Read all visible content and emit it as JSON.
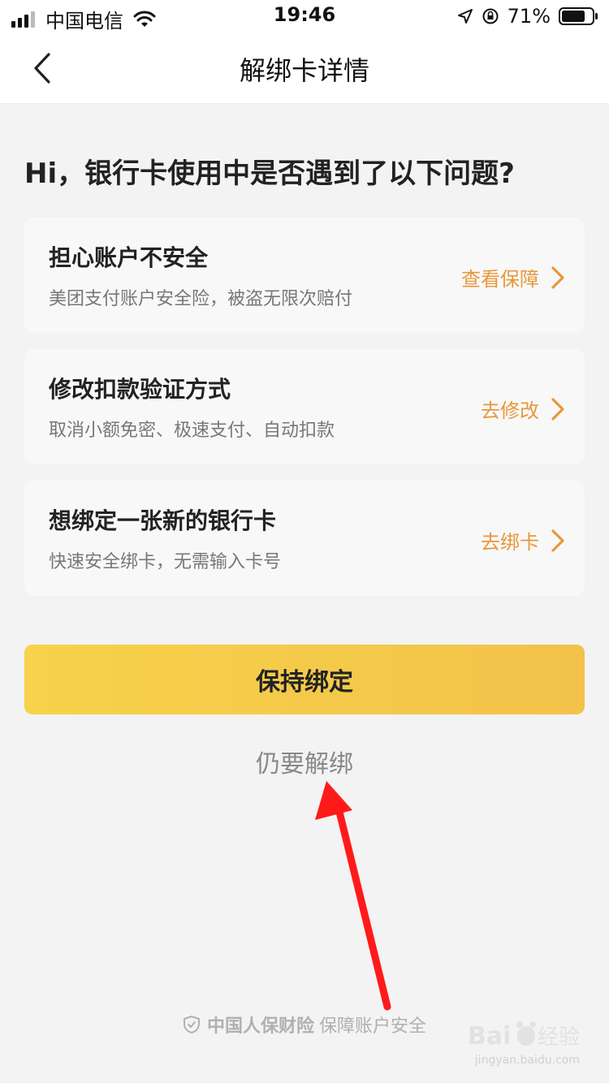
{
  "status_bar": {
    "carrier": "中国电信",
    "time": "19:46",
    "battery": "71%",
    "icons": [
      "signal-icon",
      "wifi-icon",
      "location-arrow-icon",
      "rotation-lock-icon",
      "battery-icon"
    ]
  },
  "nav": {
    "title": "解绑卡详情",
    "back_icon": "chevron-left-icon"
  },
  "heading": "Hi，银行卡使用中是否遇到了以下问题?",
  "cards": [
    {
      "title": "担心账户不安全",
      "description": "美团支付账户安全险，被盗无限次赔付",
      "action": "查看保障"
    },
    {
      "title": "修改扣款验证方式",
      "description": "取消小额免密、极速支付、自动扣款",
      "action": "去修改"
    },
    {
      "title": "想绑定一张新的银行卡",
      "description": "快速安全绑卡，无需输入卡号",
      "action": "去绑卡"
    }
  ],
  "buttons": {
    "keep_bind": "保持绑定",
    "unbind": "仍要解绑"
  },
  "footer": {
    "brand": "中国人保财险",
    "text": "保障账户安全",
    "icon": "shield-check-icon"
  },
  "watermark": {
    "text": "jingyan.baidu.com"
  },
  "colors": {
    "accent": "#e8973a",
    "button": "#f5c94a",
    "annotation": "#ff1a1a",
    "background": "#f3f3f3"
  }
}
